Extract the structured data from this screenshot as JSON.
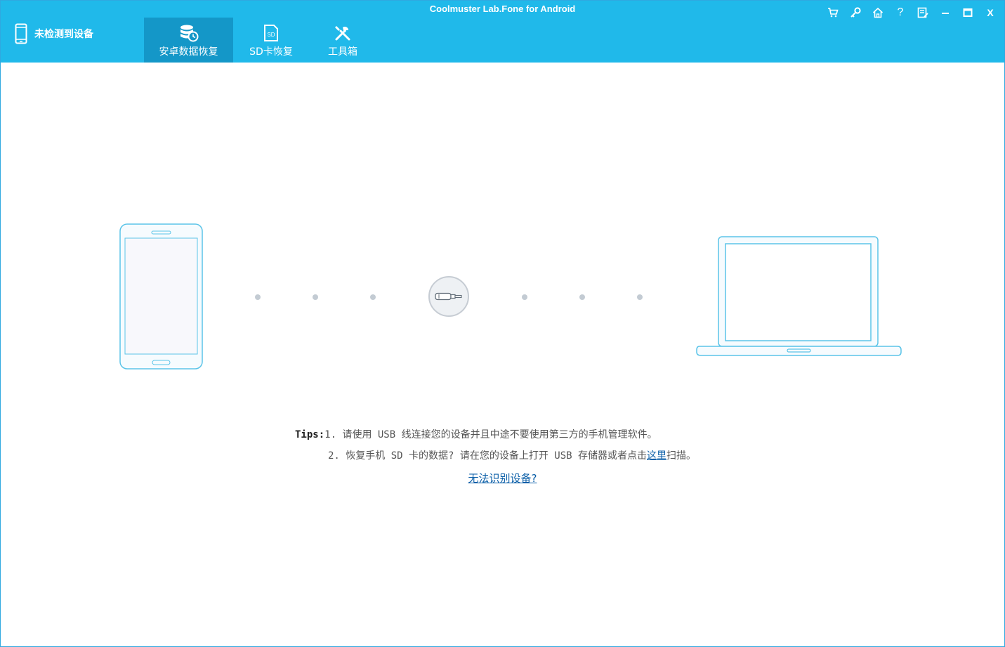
{
  "app": {
    "title": "Coolmuster Lab.Fone for Android"
  },
  "device_status": {
    "label": "未检测到设备",
    "icon": "phone-icon"
  },
  "tabs": [
    {
      "label": "安卓数据恢复",
      "icon": "database-recovery-icon",
      "active": true
    },
    {
      "label": "SD卡恢复",
      "icon": "sd-card-icon",
      "active": false
    },
    {
      "label": "工具箱",
      "icon": "tools-icon",
      "active": false
    }
  ],
  "window_controls": [
    "cart-icon",
    "key-icon",
    "home-icon",
    "help-icon",
    "feedback-icon",
    "minimize-icon",
    "maximize-icon",
    "close-icon"
  ],
  "window_controls_text": {
    "help": "?",
    "close": "X"
  },
  "tips": {
    "label": "Tips:",
    "line1": "1. 请使用 USB 线连接您的设备并且中途不要使用第三方的手机管理软件。",
    "line2_prefix": "2. 恢复手机 SD 卡的数据? 请在您的设备上打开 USB 存储器或者点击",
    "line2_link": "这里",
    "line2_suffix": "扫描。"
  },
  "unrecognized_link": "无法识别设备?",
  "colors": {
    "header": "#20b9ea",
    "active_tab": "#1497c8",
    "illustration_stroke": "#5bc4e8",
    "dot": "#c3cbd3",
    "link": "#0b5fa8"
  }
}
